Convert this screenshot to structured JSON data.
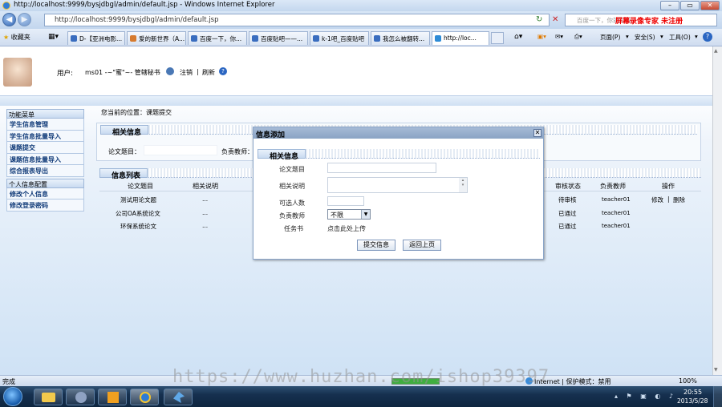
{
  "window": {
    "title": "http://localhost:9999/bysjdbgl/admin/default.jsp - Windows Internet Explorer",
    "min": "–",
    "max": "▭",
    "close": "✕"
  },
  "address": {
    "url": "http://localhost:9999/bysjdbgl/admin/default.jsp",
    "search_placeholder": "百度一下，你就知道",
    "reg_text": "屏幕录像专家 未注册"
  },
  "favorites": {
    "label": "收藏夹"
  },
  "tabs": [
    "D-【亚洲电影...",
    "爱的新世界（A...",
    "百度一下，你...",
    "百度贴吧——...",
    "k-1吧_百度贴吧",
    "我怎么被翻转...",
    "http://loc..."
  ],
  "commands": {
    "page": "页面(P)",
    "safety": "安全(S)",
    "tools": "工具(O)"
  },
  "header": {
    "user_label": "用户:",
    "user_name": "ms01 -~\"蜜\"~- 管辖秘书",
    "logout": "注销",
    "refresh": "刷新"
  },
  "sidebar": {
    "sections": [
      {
        "title": "功能菜单",
        "items": [
          "学生信息管理",
          "学生信息批量导入",
          "课题提交",
          "课题信息批量导入",
          "综合报表导出"
        ]
      },
      {
        "title": "个人信息配置",
        "items": [
          "修改个人信息",
          "修改登录密码"
        ]
      }
    ]
  },
  "main": {
    "breadcrumb": "您当前的位置：课题提交",
    "info_section": "相关信息",
    "thesis_label": "论文题目：",
    "teacher_label": "负责教师：",
    "list_section": "信息列表",
    "columns": [
      "论文题目",
      "相关说明",
      "审核状态",
      "负责教师",
      "操作"
    ],
    "rows": [
      {
        "title": "测试用论文题",
        "desc": "...",
        "status": "待审核",
        "teacher": "teacher01",
        "edit": "修改",
        "del": "删除"
      },
      {
        "title": "公司OA系统论文",
        "desc": "...",
        "status": "已通过",
        "teacher": "teacher01"
      },
      {
        "title": "环保系统论文",
        "desc": "...",
        "status": "已通过",
        "teacher": "teacher01"
      }
    ]
  },
  "dialog": {
    "title": "信息添加",
    "close": "✕",
    "section": "相关信息",
    "fields": {
      "thesis": "论文题目",
      "desc": "相关说明",
      "capacity": "可选人数",
      "teacher": "负责教师",
      "task": "任务书"
    },
    "teacher_value": "不限",
    "upload_text": "点击此处上传",
    "submit": "提交信息",
    "back": "返回上页"
  },
  "status": {
    "left": "完成",
    "zone": "Internet | 保护模式：禁用",
    "zoom": "100%"
  },
  "clock": {
    "time": "20:55",
    "date": "2013/5/28"
  },
  "watermark": "https://www.huzhan.com/ishop39397"
}
